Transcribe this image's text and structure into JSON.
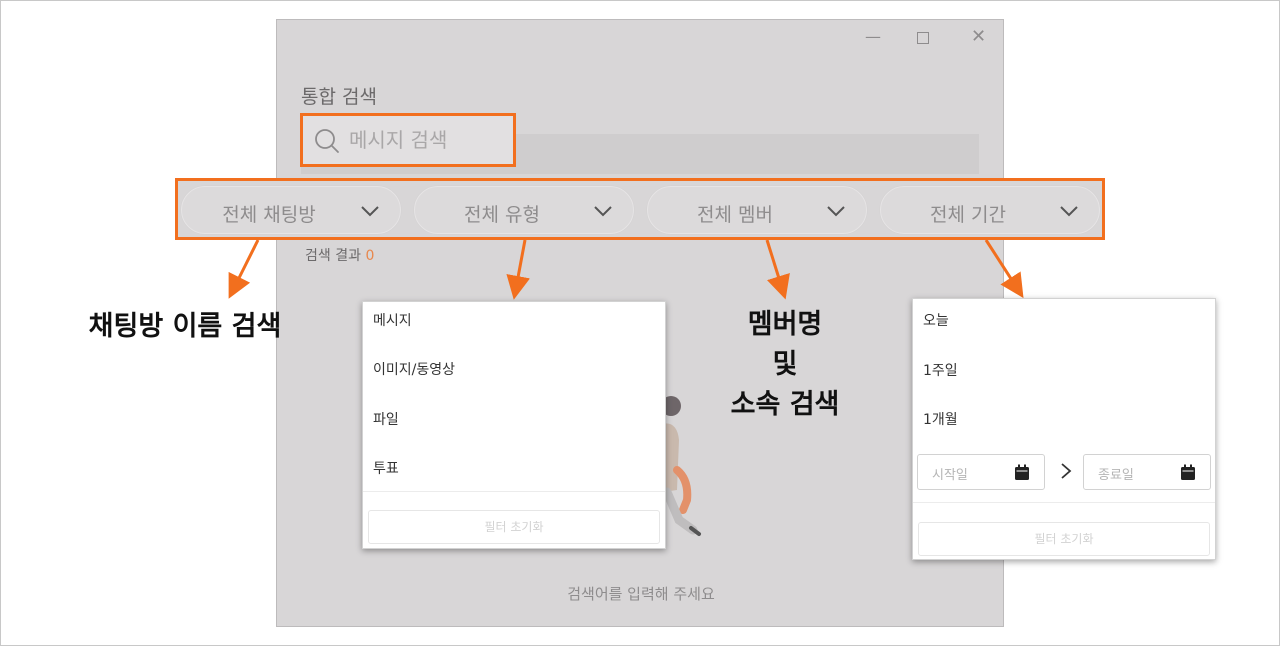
{
  "window": {
    "title": "통합 검색",
    "controls": {
      "minimize": "—",
      "close": "✕"
    }
  },
  "search": {
    "placeholder": "메시지 검색"
  },
  "filters": [
    {
      "label": "전체 채팅방"
    },
    {
      "label": "전체 유형"
    },
    {
      "label": "전체 멤버"
    },
    {
      "label": "전체 기간"
    }
  ],
  "results": {
    "label": "검색 결과",
    "count": "0"
  },
  "empty_message": "검색어를 입력해 주세요",
  "annotations": {
    "chatroom": "채팅방 이름 검색",
    "member_line1": "멤버명",
    "member_line2": "및",
    "member_line3": "소속 검색"
  },
  "type_dropdown": {
    "items": [
      "메시지",
      "이미지/동영상",
      "파일",
      "투표"
    ],
    "reset": "필터 초기화"
  },
  "period_dropdown": {
    "items": [
      "오늘",
      "1주일",
      "1개월"
    ],
    "start_placeholder": "시작일",
    "end_placeholder": "종료일",
    "reset": "필터 초기화"
  },
  "colors": {
    "highlight": "#f26f1e",
    "window_bg": "#d8d6d7",
    "count": "#e8874c"
  }
}
